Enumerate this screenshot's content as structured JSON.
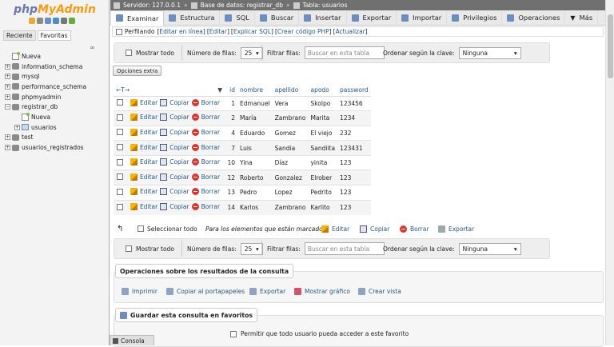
{
  "sidebar": {
    "logo_a": "php",
    "logo_b": "MyAdmin",
    "tabs": [
      "Reciente",
      "Favoritas"
    ],
    "tree": [
      {
        "label": "Nueva",
        "type": "new",
        "indent": 0
      },
      {
        "label": "information_schema",
        "type": "db",
        "indent": 0
      },
      {
        "label": "mysql",
        "type": "db",
        "indent": 0
      },
      {
        "label": "performance_schema",
        "type": "db",
        "indent": 0
      },
      {
        "label": "phpmyadmin",
        "type": "db",
        "indent": 0
      },
      {
        "label": "registrar_db",
        "type": "db-open",
        "indent": 0
      },
      {
        "label": "Nueva",
        "type": "new",
        "indent": 1
      },
      {
        "label": "usuarios",
        "type": "table",
        "indent": 1
      },
      {
        "label": "test",
        "type": "db",
        "indent": 0
      },
      {
        "label": "usuarios_registrados",
        "type": "db",
        "indent": 0
      }
    ]
  },
  "breadcrumb": {
    "server": "Servidor: 127.0.0.1",
    "database": "Base de datos: registrar_db",
    "table": "Tabla: usuarios"
  },
  "menu": [
    {
      "label": "Examinar",
      "icon": "browse-icon",
      "active": true
    },
    {
      "label": "Estructura",
      "icon": "structure-icon"
    },
    {
      "label": "SQL",
      "icon": "sql-icon"
    },
    {
      "label": "Buscar",
      "icon": "search-icon"
    },
    {
      "label": "Insertar",
      "icon": "insert-icon"
    },
    {
      "label": "Exportar",
      "icon": "export-icon"
    },
    {
      "label": "Importar",
      "icon": "import-icon"
    },
    {
      "label": "Privilegios",
      "icon": "privileges-icon"
    },
    {
      "label": "Operaciones",
      "icon": "operations-icon"
    },
    {
      "label": "Más",
      "icon": "more-icon"
    }
  ],
  "profiling": {
    "label": "Perfilando",
    "links": [
      "Editar en línea",
      "Editar",
      "Explicar SQL",
      "Crear código PHP",
      "Actualizar"
    ]
  },
  "nav": {
    "show_all": "Mostrar todo",
    "rows_label": "Número de filas:",
    "rows_value": "25",
    "filter_label": "Filtrar filas:",
    "filter_placeholder": "Buscar en esta tabla",
    "sort_label": "Ordenar según la clave:",
    "sort_value": "Ninguna"
  },
  "extra_options": "Opciones extra",
  "table": {
    "arrows": "←T→",
    "columns": [
      "id",
      "nombre",
      "apellido",
      "apodo",
      "password"
    ],
    "actions": {
      "edit": "Editar",
      "copy": "Copiar",
      "delete": "Borrar"
    },
    "rows": [
      [
        "1",
        "Edmanuel",
        "Vera",
        "Skolpo",
        "123456"
      ],
      [
        "2",
        "María",
        "Zambrano",
        "Marita",
        "1234"
      ],
      [
        "4",
        "Eduardo",
        "Gomez",
        "El viejo",
        "232"
      ],
      [
        "7",
        "Luis",
        "Sandia",
        "Sandiita",
        "123431"
      ],
      [
        "10",
        "Yina",
        "Díaz",
        "yinita",
        "123"
      ],
      [
        "12",
        "Roberto",
        "Gonzalez",
        "Elrober",
        "123"
      ],
      [
        "13",
        "Pedro",
        "Lopez",
        "Pedrito",
        "123"
      ],
      [
        "14",
        "Karlos",
        "Zambrano",
        "Karlito",
        "123"
      ]
    ]
  },
  "bulk": {
    "select_all": "Seleccionar todo",
    "marked": "Para los elementos que están marcados:",
    "edit": "Editar",
    "copy": "Copiar",
    "delete": "Borrar",
    "export": "Exportar"
  },
  "query_ops": {
    "title": "Operaciones sobre los resultados de la consulta",
    "items": [
      "Imprimir",
      "Copiar al portapapeles",
      "Exportar",
      "Mostrar gráfico",
      "Crear vista"
    ]
  },
  "bookmark": {
    "title": "Guardar esta consulta en favoritos",
    "allow": "Permitir que todo usuario pueda acceder a este favorito"
  },
  "console": "Consola",
  "colors": {
    "link": "#235a81",
    "accent": "#6c78af",
    "orange": "#f89c0e"
  }
}
